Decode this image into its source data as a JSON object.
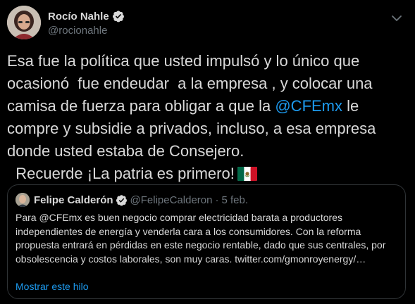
{
  "author": {
    "display_name": "Rocío Nahle",
    "handle": "@rocionahle"
  },
  "tweet": {
    "text_before": "Esa fue la política que usted impulsó y lo único que ocasionó  fue endeudar  a la empresa , y colocar una camisa de fuerza para obligar a que la ",
    "mention": "@CFEmx",
    "text_after": " le compre y subsidie a privados, incluso, a esa empresa donde usted estaba de Consejero.\n  Recuerde ¡La patria es primero!",
    "emoji": "mexico-flag"
  },
  "quoted_tweet": {
    "display_name": "Felipe Calderón",
    "handle": "@FelipeCalderon",
    "separator": "·",
    "date": "5 feb.",
    "body": "Para @CFEmx es buen negocio comprar electricidad barata a productores independientes de energía y venderla cara a los consumidores. Con la reforma propuesta entrará en pérdidas en este negocio rentable, dado que sus centrales, por obsolescencia y costos laborales, son muy caras. twitter.com/gmonroyenergy/…",
    "show_thread": "Mostrar este hilo"
  },
  "colors": {
    "background": "#000000",
    "text": "#d9d9d9",
    "secondary": "#6e767d",
    "accent": "#1d9bf0",
    "border": "#2f3336"
  }
}
